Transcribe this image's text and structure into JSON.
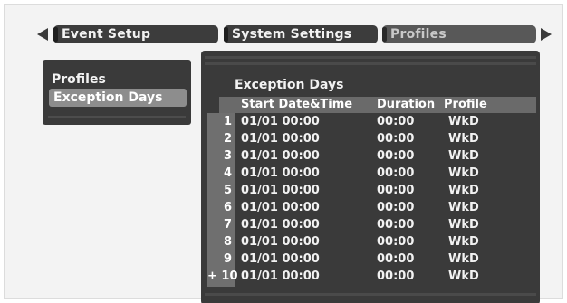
{
  "tabs": [
    {
      "label": "Event Setup",
      "active": false
    },
    {
      "label": "System Settings",
      "active": false
    },
    {
      "label": "Profiles",
      "active": true
    }
  ],
  "left_menu": {
    "items": [
      {
        "label": "Profiles",
        "selected": false
      },
      {
        "label": "Exception Days",
        "selected": true
      }
    ]
  },
  "main": {
    "title": "Exception Days",
    "columns": [
      "Start Date&Time",
      "Duration",
      "Profile"
    ],
    "rows": [
      {
        "num": "1",
        "start": "01/01 00:00",
        "duration": "00:00",
        "profile": "WkD"
      },
      {
        "num": "2",
        "start": "01/01 00:00",
        "duration": "00:00",
        "profile": "WkD"
      },
      {
        "num": "3",
        "start": "01/01 00:00",
        "duration": "00:00",
        "profile": "WkD"
      },
      {
        "num": "4",
        "start": "01/01 00:00",
        "duration": "00:00",
        "profile": "WkD"
      },
      {
        "num": "5",
        "start": "01/01 00:00",
        "duration": "00:00",
        "profile": "WkD"
      },
      {
        "num": "6",
        "start": "01/01 00:00",
        "duration": "00:00",
        "profile": "WkD"
      },
      {
        "num": "7",
        "start": "01/01 00:00",
        "duration": "00:00",
        "profile": "WkD"
      },
      {
        "num": "8",
        "start": "01/01 00:00",
        "duration": "00:00",
        "profile": "WkD"
      },
      {
        "num": "9",
        "start": "01/01 00:00",
        "duration": "00:00",
        "profile": "WkD"
      },
      {
        "num": "+ 10",
        "start": "01/01 00:00",
        "duration": "00:00",
        "profile": "WkD"
      }
    ]
  },
  "colors": {
    "background": "#ffffff",
    "panel": "#3a3a3a",
    "tab": "#3c3c3c",
    "tab_active": "#585858",
    "selected_item": "#8d8d8d",
    "header_row": "#6a6a6a",
    "text": "#f2f2f2"
  },
  "icons": {
    "prev": "triangle-left-icon",
    "next": "triangle-right-icon"
  }
}
